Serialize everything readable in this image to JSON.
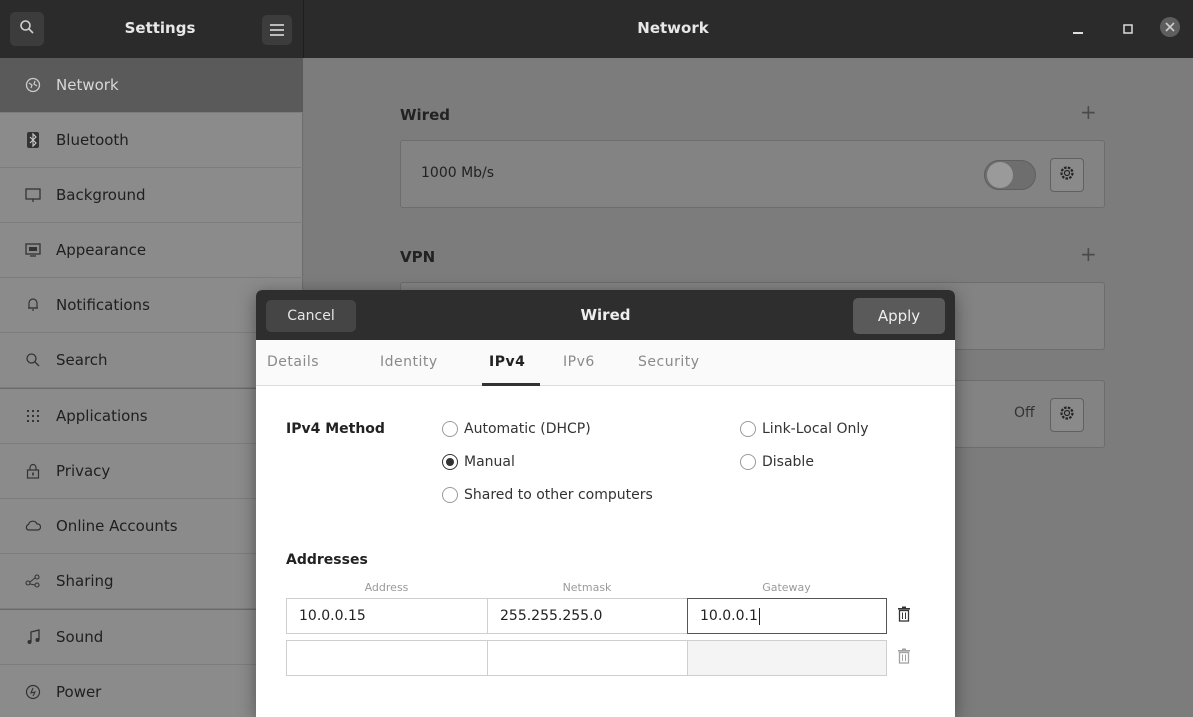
{
  "window": {
    "left_title": "Settings",
    "center_title": "Network"
  },
  "sidebar": {
    "items": [
      {
        "label": "Network",
        "icon": "network-icon"
      },
      {
        "label": "Bluetooth",
        "icon": "bluetooth-icon"
      },
      {
        "label": "Background",
        "icon": "background-icon"
      },
      {
        "label": "Appearance",
        "icon": "appearance-icon"
      },
      {
        "label": "Notifications",
        "icon": "bell-icon"
      },
      {
        "label": "Search",
        "icon": "search-icon"
      },
      {
        "label": "Applications",
        "icon": "grid-icon"
      },
      {
        "label": "Privacy",
        "icon": "lock-icon"
      },
      {
        "label": "Online Accounts",
        "icon": "cloud-icon"
      },
      {
        "label": "Sharing",
        "icon": "share-icon"
      },
      {
        "label": "Sound",
        "icon": "music-note-icon"
      },
      {
        "label": "Power",
        "icon": "power-icon"
      }
    ]
  },
  "main": {
    "wired": {
      "title": "Wired",
      "speed": "1000 Mb/s"
    },
    "vpn": {
      "title": "VPN"
    },
    "proxy": {
      "status": "Off"
    }
  },
  "dialog": {
    "title": "Wired",
    "cancel_label": "Cancel",
    "apply_label": "Apply",
    "tabs": [
      "Details",
      "Identity",
      "IPv4",
      "IPv6",
      "Security"
    ],
    "active_tab": "IPv4",
    "method_label": "IPv4 Method",
    "methods": {
      "automatic": "Automatic (DHCP)",
      "manual": "Manual",
      "shared": "Shared to other computers",
      "link_local": "Link-Local Only",
      "disable": "Disable"
    },
    "selected_method": "Manual",
    "addresses_label": "Addresses",
    "columns": [
      "Address",
      "Netmask",
      "Gateway"
    ],
    "rows": [
      {
        "address": "10.0.0.15",
        "netmask": "255.255.255.0",
        "gateway": "10.0.0.1"
      },
      {
        "address": "",
        "netmask": "",
        "gateway": ""
      }
    ]
  }
}
